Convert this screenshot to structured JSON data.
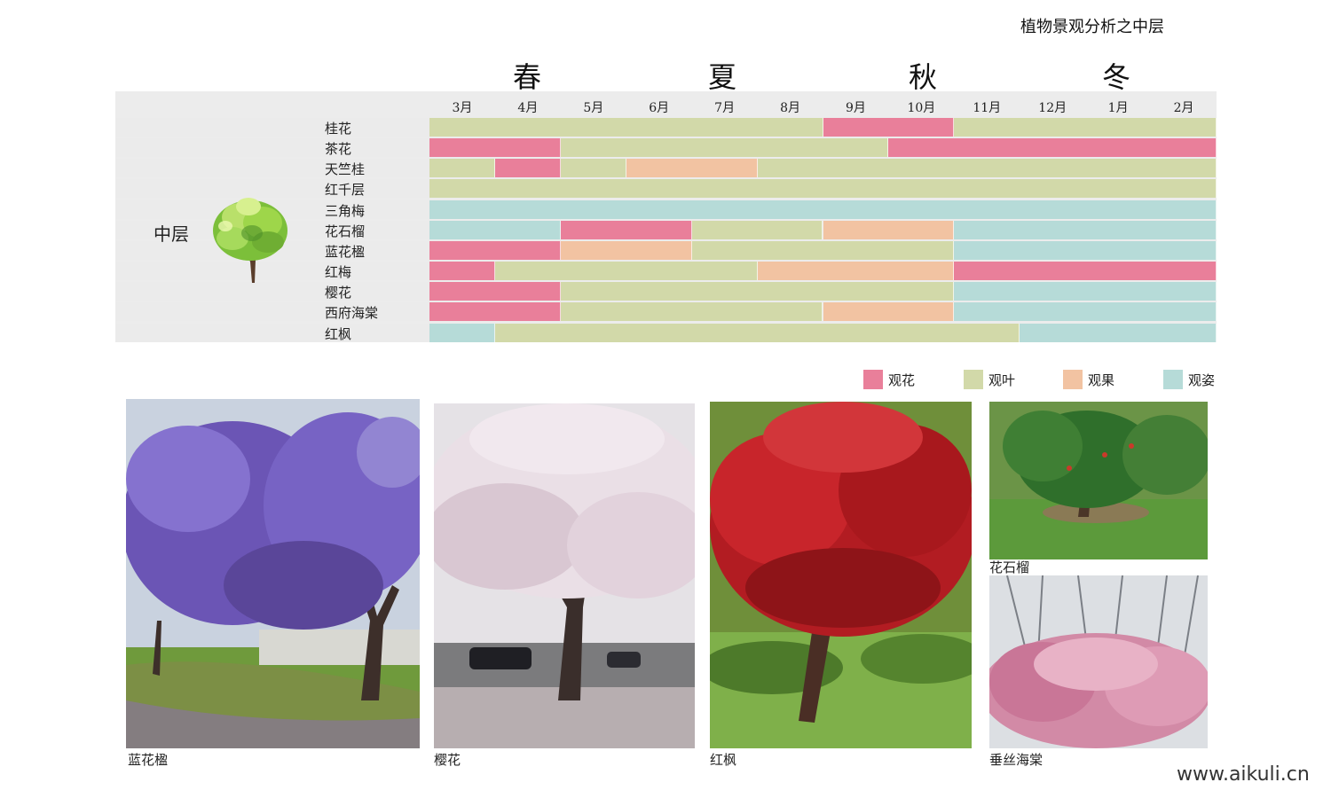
{
  "title": "植物景观分析之中层",
  "seasons": [
    "春",
    "夏",
    "秋",
    "冬"
  ],
  "months": [
    "3月",
    "4月",
    "5月",
    "6月",
    "7月",
    "8月",
    "9月",
    "10月",
    "11月",
    "12月",
    "1月",
    "2月"
  ],
  "layer_label": "中层",
  "legend": [
    {
      "key": "flower",
      "label": "观花",
      "color": "#e97f9a"
    },
    {
      "key": "leaf",
      "label": "观叶",
      "color": "#d2d9a9"
    },
    {
      "key": "fruit",
      "label": "观果",
      "color": "#f2c3a2"
    },
    {
      "key": "form",
      "label": "观姿",
      "color": "#b6dbd8"
    }
  ],
  "chart_data": {
    "type": "table",
    "columns": [
      "3月",
      "4月",
      "5月",
      "6月",
      "7月",
      "8月",
      "9月",
      "10月",
      "11月",
      "12月",
      "1月",
      "2月"
    ],
    "rows": [
      {
        "name": "桂花",
        "periods": [
          {
            "from": 0,
            "to": 6,
            "type": "leaf"
          },
          {
            "from": 6,
            "to": 8,
            "type": "flower"
          },
          {
            "from": 8,
            "to": 12,
            "type": "leaf"
          }
        ]
      },
      {
        "name": "茶花",
        "periods": [
          {
            "from": 0,
            "to": 2,
            "type": "flower"
          },
          {
            "from": 2,
            "to": 7,
            "type": "leaf"
          },
          {
            "from": 7,
            "to": 12,
            "type": "flower"
          }
        ]
      },
      {
        "name": "天竺桂",
        "periods": [
          {
            "from": 0,
            "to": 1,
            "type": "leaf"
          },
          {
            "from": 1,
            "to": 2,
            "type": "flower"
          },
          {
            "from": 2,
            "to": 3,
            "type": "leaf"
          },
          {
            "from": 3,
            "to": 5,
            "type": "fruit"
          },
          {
            "from": 5,
            "to": 12,
            "type": "leaf"
          }
        ]
      },
      {
        "name": "红千层",
        "periods": [
          {
            "from": 0,
            "to": 12,
            "type": "leaf"
          }
        ]
      },
      {
        "name": "三角梅",
        "periods": [
          {
            "from": 0,
            "to": 12,
            "type": "form"
          }
        ]
      },
      {
        "name": "花石榴",
        "periods": [
          {
            "from": 0,
            "to": 2,
            "type": "form"
          },
          {
            "from": 2,
            "to": 4,
            "type": "flower"
          },
          {
            "from": 4,
            "to": 6,
            "type": "leaf"
          },
          {
            "from": 6,
            "to": 8,
            "type": "fruit"
          },
          {
            "from": 8,
            "to": 12,
            "type": "form"
          }
        ]
      },
      {
        "name": "蓝花楹",
        "periods": [
          {
            "from": 0,
            "to": 2,
            "type": "flower"
          },
          {
            "from": 2,
            "to": 4,
            "type": "fruit"
          },
          {
            "from": 4,
            "to": 8,
            "type": "leaf"
          },
          {
            "from": 8,
            "to": 12,
            "type": "form"
          }
        ]
      },
      {
        "name": "红梅",
        "periods": [
          {
            "from": 0,
            "to": 1,
            "type": "flower"
          },
          {
            "from": 1,
            "to": 5,
            "type": "leaf"
          },
          {
            "from": 5,
            "to": 8,
            "type": "fruit"
          },
          {
            "from": 8,
            "to": 12,
            "type": "flower"
          }
        ]
      },
      {
        "name": "樱花",
        "periods": [
          {
            "from": 0,
            "to": 2,
            "type": "flower"
          },
          {
            "from": 2,
            "to": 8,
            "type": "leaf"
          },
          {
            "from": 8,
            "to": 12,
            "type": "form"
          }
        ]
      },
      {
        "name": "西府海棠",
        "periods": [
          {
            "from": 0,
            "to": 2,
            "type": "flower"
          },
          {
            "from": 2,
            "to": 6,
            "type": "leaf"
          },
          {
            "from": 6,
            "to": 8,
            "type": "fruit"
          },
          {
            "from": 8,
            "to": 12,
            "type": "form"
          }
        ]
      },
      {
        "name": "红枫",
        "periods": [
          {
            "from": 0,
            "to": 1,
            "type": "form"
          },
          {
            "from": 1,
            "to": 9,
            "type": "leaf"
          },
          {
            "from": 9,
            "to": 12,
            "type": "form"
          }
        ]
      }
    ]
  },
  "photos": [
    {
      "caption": "蓝花楹"
    },
    {
      "caption": "樱花"
    },
    {
      "caption": "红枫"
    },
    {
      "caption": "花石榴"
    },
    {
      "caption": "垂丝海棠"
    }
  ],
  "watermark": "www.aikuli.cn"
}
